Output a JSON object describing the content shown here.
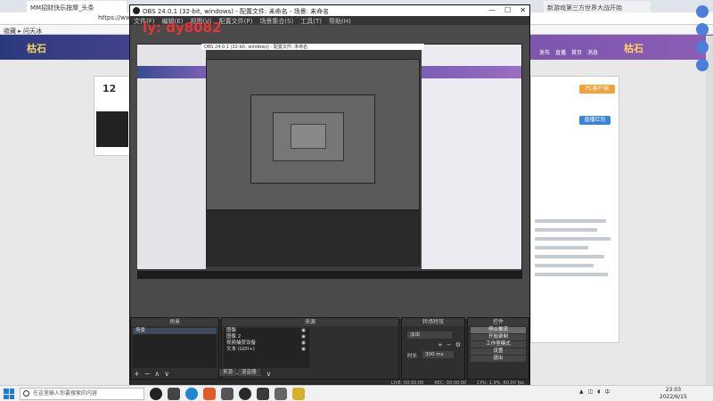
{
  "browser": {
    "tab_title": "MM招财快乐按摩_头条",
    "tab2_title": "新游戏第三方世界大战开始",
    "url": "https://www",
    "bookmarks_label": "收藏 ▸ 问天冰",
    "site_logo": "枯石",
    "site_logo_right": "枯石",
    "nav_items": [
      "发布",
      "直播",
      "首页",
      "消息"
    ],
    "left_count": "12",
    "pc_button": "PC客户端",
    "blue_badge": "直播红包"
  },
  "watermark": "ly: dy8082",
  "obs": {
    "title": "OBS 24.0.1 (32-bit, windows) - 配置文件: 未命名 - 场景: 未命名",
    "window_controls": [
      "—",
      "☐",
      "✕"
    ],
    "menu": [
      "文件(F)",
      "编辑(E)",
      "视图(V)",
      "配置文件(P)",
      "场景集合(S)",
      "工具(T)",
      "帮助(H)"
    ],
    "recorded_title": "OBS 24.0.1 (32-bit, windows) - 配置文件: 未命名",
    "docks": {
      "scenes": {
        "header": "场景",
        "items": [
          "场景"
        ],
        "tools": [
          "+",
          "−",
          "∧",
          "∨"
        ]
      },
      "sources": {
        "header": "来源",
        "items": [
          {
            "name": "图像"
          },
          {
            "name": "图像 2"
          },
          {
            "name": "视频捕获设备"
          },
          {
            "name": "文本 (GDI+)"
          }
        ],
        "tools": [
          "+",
          "−",
          "⚙",
          "∧",
          "∨"
        ]
      },
      "mixer": {
        "tabs": [
          "来源",
          "混音器"
        ]
      },
      "transitions": {
        "header": "转场特效",
        "selected": "淡出",
        "duration_label": "时长",
        "duration": "300 ms",
        "tools": [
          "+",
          "−",
          "⚙"
        ]
      },
      "controls": {
        "header": "控件",
        "buttons": [
          "停止推流",
          "开始录制",
          "工作室模式",
          "设置",
          "退出"
        ]
      }
    },
    "status": [
      "LIVE: 00:00:00",
      "REC: 00:00:00",
      "CPU: 1.9%, 60.00 fps"
    ]
  },
  "taskbar": {
    "search_placeholder": "在这里输入你要搜索的内容",
    "time": "23:03",
    "date": "2022/6/15"
  },
  "colors": {
    "obs_bg": "#2b2b2b",
    "banner_start": "#2b3a7e",
    "banner_end": "#8d5db5",
    "watermark": "#ff3333",
    "windows_blue": "#1e7bd6"
  }
}
